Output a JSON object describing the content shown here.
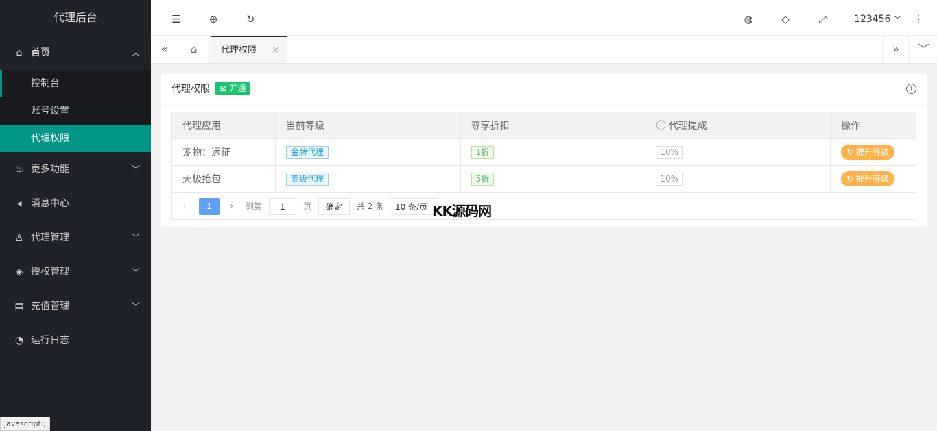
{
  "sidebar": {
    "logo": "代理后台",
    "home": {
      "label": "首页",
      "icon": "home-icon"
    },
    "home_items": [
      "控制台",
      "账号设置",
      "代理权限"
    ],
    "more": {
      "label": "更多功能"
    },
    "messages": {
      "label": "消息中心"
    },
    "agents": {
      "label": "代理管理"
    },
    "auth": {
      "label": "授权管理"
    },
    "recharge": {
      "label": "充值管理"
    },
    "logs": {
      "label": "运行日志"
    }
  },
  "header": {
    "username": "123456"
  },
  "tabs": {
    "current": "代理权限"
  },
  "card": {
    "title": "代理权限",
    "badge": "开通",
    "columns": [
      "代理应用",
      "当前等级",
      "尊享折扣",
      "代理提成",
      "操作"
    ],
    "rows": [
      {
        "app": "宠物：远征",
        "level": "金牌代理",
        "discount": "1折",
        "commission": "10%",
        "action": "提升等级"
      },
      {
        "app": "天极抢包",
        "level": "高级代理",
        "discount": "5折",
        "commission": "10%",
        "action": "提升等级"
      }
    ]
  },
  "pager": {
    "current": "1",
    "goto": "到第",
    "page_input": "1",
    "page_unit": "页",
    "confirm": "确定",
    "total": "共 2 条",
    "per_page": "10 条/页"
  },
  "watermark": "KK源码网",
  "status_bar": "javascript:;",
  "colors": {
    "accent": "#009688",
    "sidebar": "#20222a",
    "badge": "#1bc56d",
    "upgrade": "#ffb249"
  }
}
